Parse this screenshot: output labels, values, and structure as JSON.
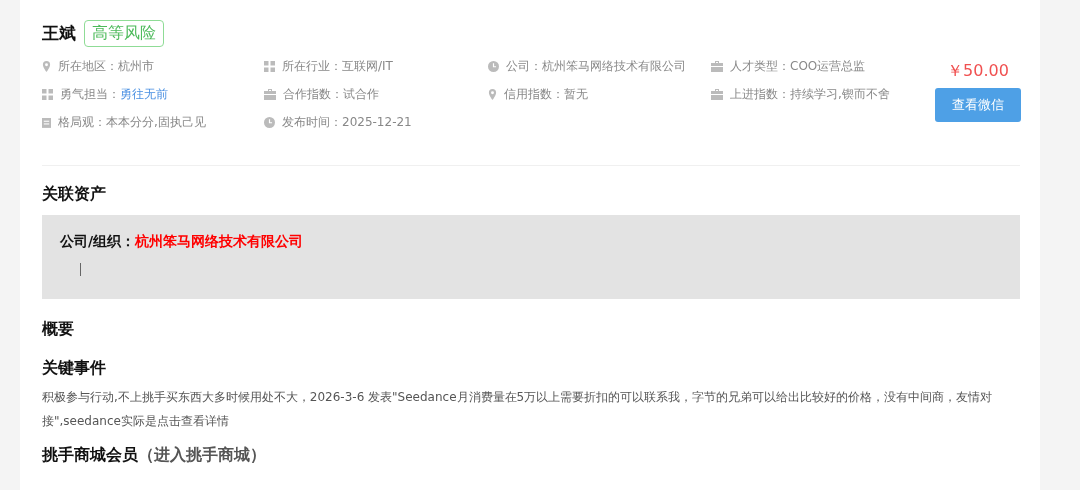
{
  "profile": {
    "name": "王斌",
    "risk_badge": "高等风险"
  },
  "info_items": [
    {
      "kind": "pin",
      "label": "所在地区：",
      "value": "杭州市",
      "highlighted": false
    },
    {
      "kind": "grid",
      "label": "所在行业：",
      "value": "互联网/IT",
      "highlighted": false
    },
    {
      "kind": "clock",
      "label": "公司：",
      "value": "杭州笨马网络技术有限公司",
      "highlighted": false
    },
    {
      "kind": "briefcase",
      "label": "人才类型：",
      "value": "COO运营总监",
      "highlighted": false
    },
    {
      "kind": "grid",
      "label": "勇气担当：",
      "value": "勇往无前",
      "highlighted": true
    },
    {
      "kind": "briefcase",
      "label": "合作指数：",
      "value": "试合作",
      "highlighted": false
    },
    {
      "kind": "pin",
      "label": "信用指数：",
      "value": "暂无",
      "highlighted": false
    },
    {
      "kind": "briefcase",
      "label": "上进指数：",
      "value": "持续学习,锲而不舍",
      "highlighted": false
    },
    {
      "kind": "calendar",
      "label": "格局观：",
      "value": "本本分分,固执己见",
      "highlighted": false
    },
    {
      "kind": "clock",
      "label": "发布时间：",
      "value": "2025-12-21",
      "highlighted": false
    }
  ],
  "price": "￥50.00",
  "wechat_button": "查看微信",
  "related_assets": {
    "heading": "关联资产",
    "label": "公司/组织：",
    "company": "杭州笨马网络技术有限公司"
  },
  "overview_heading": "概要",
  "key_events": {
    "heading": "关键事件",
    "text": "积极参与行动,不上挑手买东西大多时候用处不大，2026-3-6 发表\"Seedance月消费量在5万以上需要折扣的可以联系我，字节的兄弟可以给出比较好的价格，没有中间商，友情对接\",seedance实际是点击查看详情"
  },
  "mall": {
    "heading": "挑手商城会员",
    "link": "（进入挑手商城）"
  }
}
